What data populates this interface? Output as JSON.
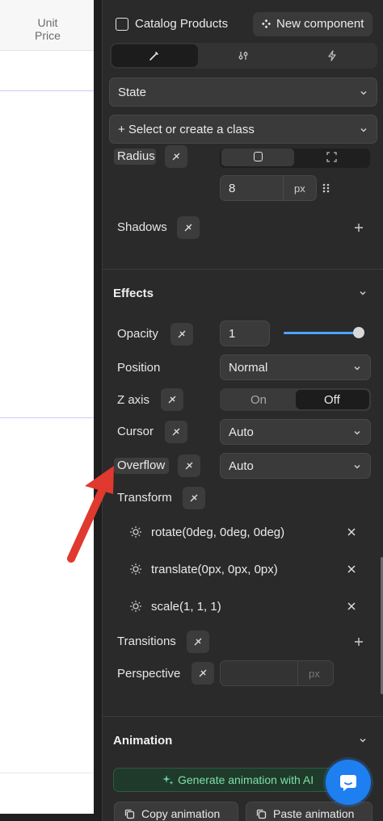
{
  "table": {
    "column_header": "Unit Price"
  },
  "header": {
    "title": "Catalog Products",
    "new_component_label": "New component"
  },
  "tabs": [
    {
      "icon": "brush-icon"
    },
    {
      "icon": "sliders-icon"
    },
    {
      "icon": "bolt-icon"
    }
  ],
  "state_select": {
    "label": "State"
  },
  "class_select": {
    "label": "+ Select or create a class"
  },
  "radius": {
    "label": "Radius",
    "value": "8",
    "unit": "px"
  },
  "shadows": {
    "label": "Shadows"
  },
  "effects": {
    "title": "Effects",
    "opacity": {
      "label": "Opacity",
      "value": "1",
      "slider_level": 1.0
    },
    "position": {
      "label": "Position",
      "value": "Normal"
    },
    "z_axis": {
      "label": "Z axis",
      "on": "On",
      "off": "Off"
    },
    "cursor": {
      "label": "Cursor",
      "value": "Auto"
    },
    "overflow": {
      "label": "Overflow",
      "value": "Auto"
    },
    "transform": {
      "label": "Transform",
      "items": [
        "rotate(0deg, 0deg, 0deg)",
        "translate(0px, 0px, 0px)",
        "scale(1, 1, 1)"
      ]
    },
    "transitions": {
      "label": "Transitions"
    },
    "perspective": {
      "label": "Perspective",
      "unit": "px"
    }
  },
  "animation": {
    "title": "Animation",
    "generate_label": "Generate animation with AI",
    "copy_label": "Copy animation",
    "paste_label": "Paste animation"
  },
  "colors": {
    "accent": "#4da3ff",
    "red_arrow": "#e0392f",
    "bg": "#2a2a2a"
  }
}
